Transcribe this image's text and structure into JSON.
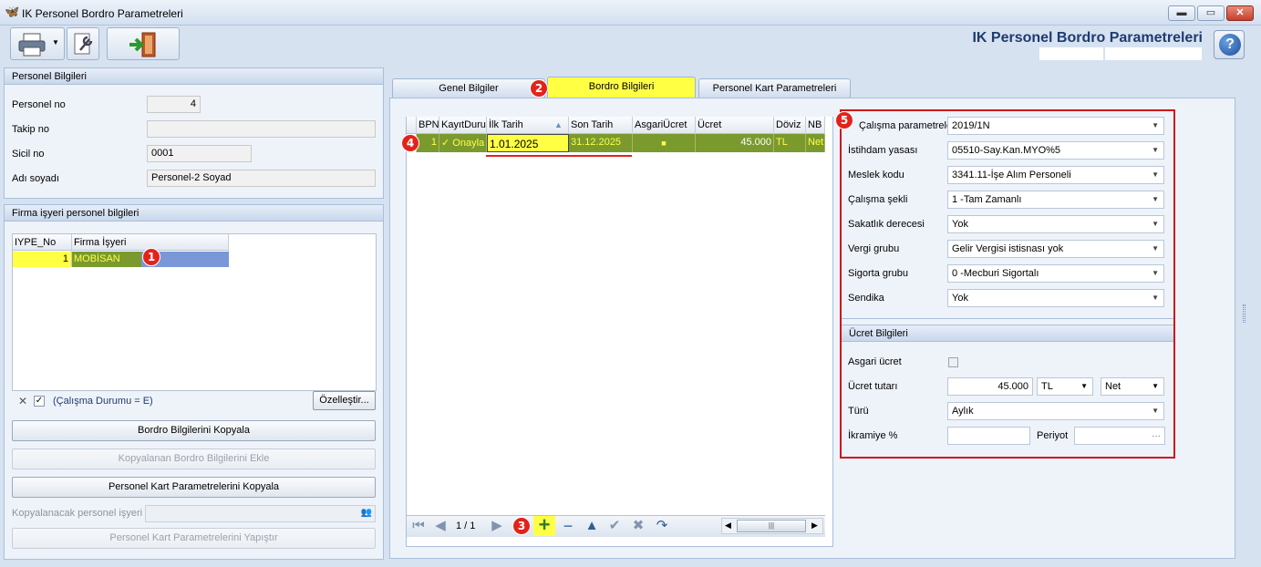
{
  "window": {
    "title": "IK Personel Bordro Parametreleri",
    "header_title": "IK Personel Bordro Parametreleri",
    "min": "▬",
    "max": "▭",
    "close": "✕"
  },
  "toolbar": {
    "print_icon": "printer-icon",
    "settings_icon": "wrench-icon",
    "exit_icon": "exit-door-icon"
  },
  "personel": {
    "group_title": "Personel Bilgileri",
    "fields": [
      {
        "label": "Personel no",
        "value": "4"
      },
      {
        "label": "Takip no",
        "value": ""
      },
      {
        "label": "Sicil no",
        "value": "0001"
      },
      {
        "label": "Adı soyadı",
        "value": "Personel-2 Soyad"
      }
    ]
  },
  "firma": {
    "group_title": "Firma işyeri personel bilgileri",
    "columns": [
      "IYPE_No",
      "Firma İşyeri"
    ],
    "rows": [
      {
        "no": "1",
        "name": "MOBİSAN"
      }
    ],
    "filter_text": "(Çalışma Durumu = E)",
    "customize_label": "Özelleştir..."
  },
  "actions": {
    "copy_bordro": "Bordro Bilgilerini Kopyala",
    "add_copied": "Kopyalanan Bordro Bilgilerini Ekle",
    "copy_card": "Personel Kart Parametrelerini Kopyala",
    "copy_target_label": "Kopyalanacak personel işyeri",
    "paste_card": "Personel Kart Parametrelerini Yapıştır"
  },
  "tabs": [
    "Genel Bilgiler",
    "Bordro Bilgileri",
    "Personel Kart Parametreleri"
  ],
  "bordro_grid": {
    "columns": [
      "BPN",
      "KayıtDurumu",
      "İlk Tarih",
      "Son Tarih",
      "AsgariÜcret",
      "Ücret",
      "Döviz",
      "NB"
    ],
    "row": {
      "bpn": "1",
      "status": "✓ Onayla",
      "start": "1.01.2025",
      "end": "31.12.2025",
      "min_wage": "■",
      "wage": "45.000",
      "currency": "TL",
      "nb": "Net"
    },
    "pager": "1 / 1"
  },
  "params": {
    "rows": [
      {
        "label": "Çalışma parametreleri",
        "value": "2019/1N"
      },
      {
        "label": "İstihdam yasası",
        "value": "05510-Say.Kan.MYO%5"
      },
      {
        "label": "Meslek kodu",
        "value": "3341.11-İşe Alım Personeli"
      },
      {
        "label": "Çalışma şekli",
        "value": "1 -Tam Zamanlı"
      },
      {
        "label": "Sakatlık derecesi",
        "value": "Yok"
      },
      {
        "label": "Vergi grubu",
        "value": "Gelir Vergisi istisnası yok"
      },
      {
        "label": "Sigorta grubu",
        "value": "0 -Mecburi Sigortalı"
      },
      {
        "label": "Sendika",
        "value": "Yok"
      }
    ],
    "wage_group_title": "Ücret Bilgileri",
    "min_wage_label": "Asgari ücret",
    "wage_amount_label": "Ücret tutarı",
    "wage_amount": "45.000",
    "wage_currency": "TL",
    "wage_net": "Net",
    "type_label": "Türü",
    "type_value": "Aylık",
    "bonus_label": "İkramiye %",
    "bonus_value": "",
    "period_label": "Periyot",
    "period_value": ""
  },
  "badges": [
    "1",
    "2",
    "3",
    "4",
    "5"
  ],
  "colors": {
    "highlight": "#ffff44",
    "row_green": "#7a9a2e",
    "callout_red": "#e3231b"
  }
}
